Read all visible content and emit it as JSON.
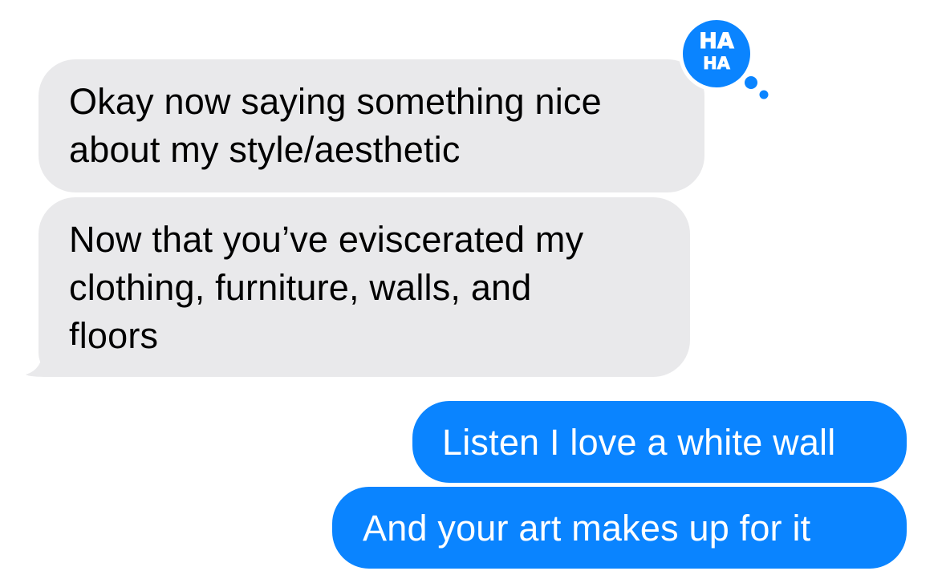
{
  "conversation": {
    "messages": [
      {
        "direction": "incoming",
        "text": "Okay now saying something nice\nabout my style/aesthetic"
      },
      {
        "direction": "incoming",
        "text": "Now that you’ve eviscerated my\nclothing, furniture, walls, and\nfloors"
      },
      {
        "direction": "outgoing",
        "text": "Listen I love a white wall"
      },
      {
        "direction": "outgoing",
        "text": "And your art makes up for it"
      }
    ]
  },
  "reaction": {
    "type": "haha",
    "line1": "HA",
    "line2": "HA",
    "icon": "haha-tapback-icon"
  },
  "colors": {
    "incoming_bubble": "#e9e9eb",
    "outgoing_bubble": "#0a84ff",
    "reaction_bubble": "#0a84ff"
  }
}
